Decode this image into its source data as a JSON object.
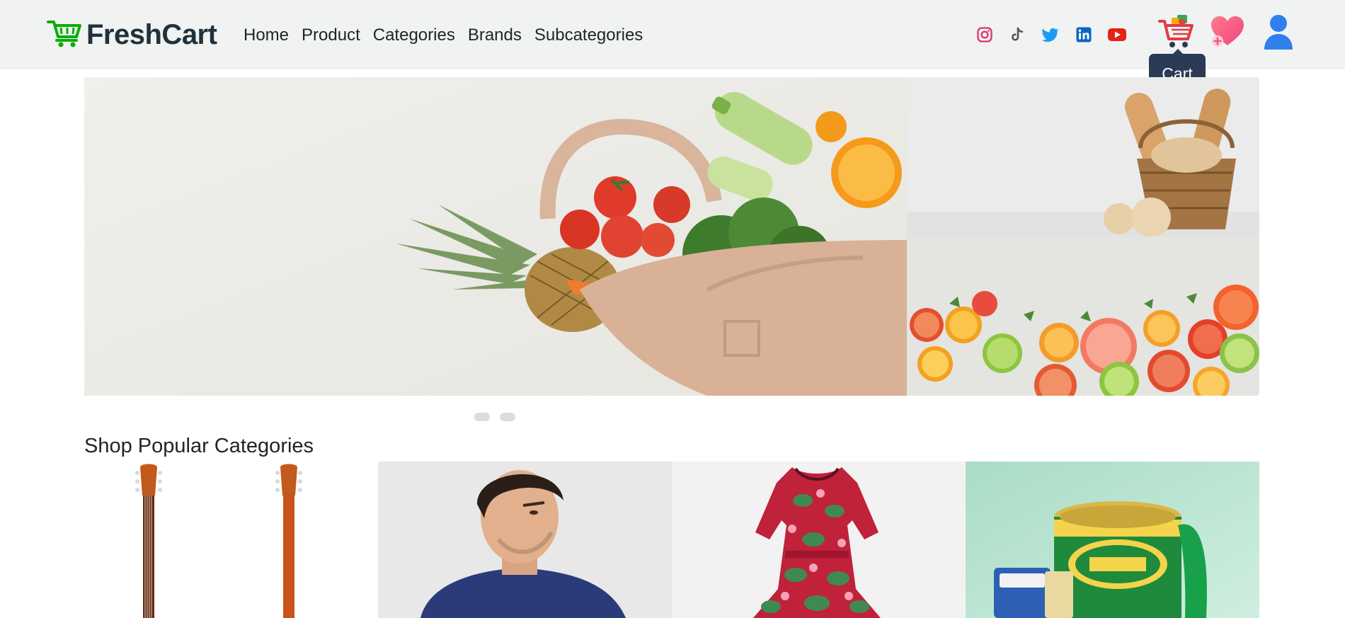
{
  "brand": {
    "name": "FreshCart",
    "icon": "shopping-cart-icon",
    "color": "#0aad0a"
  },
  "nav": {
    "links": [
      "Home",
      "Product",
      "Categories",
      "Brands",
      "Subcategories"
    ]
  },
  "social": [
    {
      "icon": "instagram-icon",
      "color": "#e1306c"
    },
    {
      "icon": "tiktok-icon",
      "color": "#555555"
    },
    {
      "icon": "twitter-icon",
      "color": "#1d9bf0"
    },
    {
      "icon": "linkedin-icon",
      "color": "#0a66c2"
    },
    {
      "icon": "youtube-icon",
      "color": "#e62117"
    }
  ],
  "actions": {
    "cart_icon": "cart-icon",
    "wishlist_icon": "heart-icon",
    "user_icon": "user-icon",
    "tooltip": "Cart"
  },
  "slider": {
    "slides": 2,
    "active": 1
  },
  "categories": {
    "title": "Shop Popular Categories",
    "items": [
      "guitars",
      "men-hoodie",
      "floral-dress",
      "grocery-can"
    ]
  },
  "colors": {
    "nav_bg": "#f0f3f2",
    "tooltip_bg": "#2b3a55",
    "accent": "#0aad0a"
  }
}
